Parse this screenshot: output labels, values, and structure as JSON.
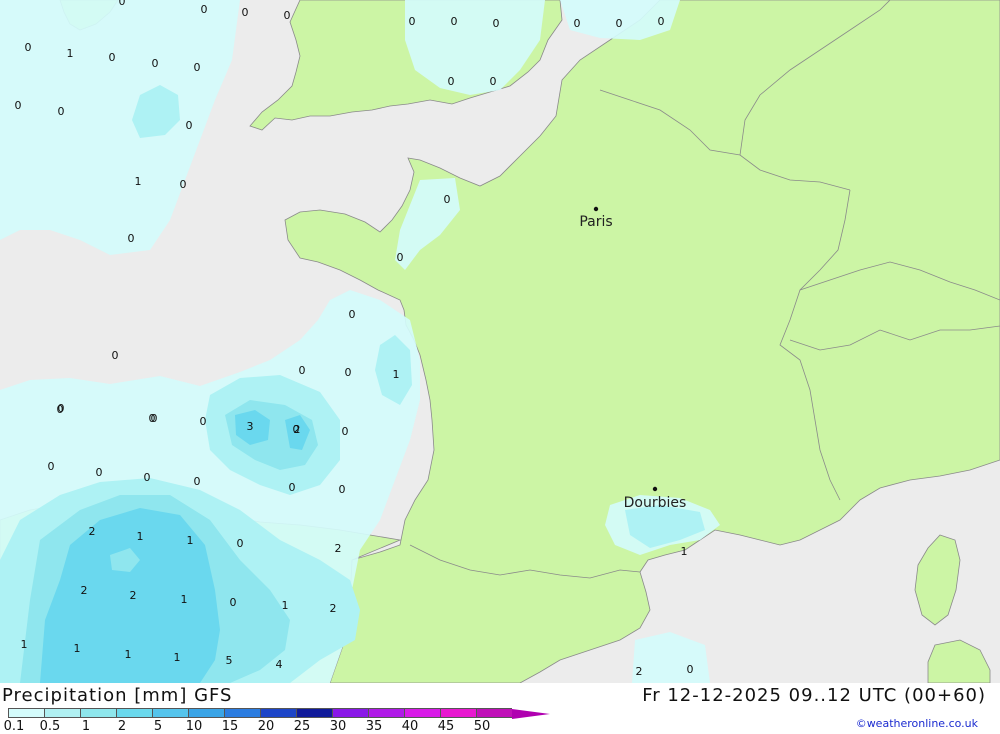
{
  "title": "Precipitation [mm] GFS",
  "datetime": "Fr 12-12-2025 09..12 UTC (00+60)",
  "credit": "©weatheronline.co.uk",
  "colors": {
    "sea": "#ececec",
    "land": "#ccf5a5",
    "border": "#8a8a8a",
    "level_0_1": "#d4fbfb",
    "level_0_5": "#aef2f4",
    "level_1": "#8fe6ee",
    "level_2": "#6ad8ee"
  },
  "legend": {
    "ticks": [
      "0.1",
      "0.5",
      "1",
      "2",
      "5",
      "10",
      "15",
      "20",
      "25",
      "30",
      "35",
      "40",
      "45",
      "50"
    ],
    "colors": [
      "#d4fbfb",
      "#b0f0f2",
      "#8ee6ec",
      "#6ad8ec",
      "#55c4ec",
      "#3aa4e6",
      "#2b7ce0",
      "#1d45c8",
      "#101a9a",
      "#8a18e8",
      "#b01ae8",
      "#d81ae8",
      "#e818d0",
      "#c010b8"
    ]
  },
  "cities": [
    {
      "name": "Paris"
    },
    {
      "name": "Dourbies"
    }
  ],
  "values": [
    "0",
    "0",
    "0",
    "0",
    "0",
    "0",
    "1",
    "0",
    "0",
    "0",
    "0",
    "0",
    "0",
    "0",
    "0",
    "0",
    "0",
    "0",
    "0",
    "0",
    "1",
    "0",
    "0",
    "0",
    "0",
    "0",
    "0",
    "0",
    "0",
    "0",
    "0",
    "0",
    "0",
    "1",
    "0",
    "0",
    "0",
    "3",
    "2",
    "0",
    "0",
    "0",
    "2",
    "1",
    "1",
    "0",
    "2",
    "1",
    "2",
    "1",
    "0",
    "1",
    "2",
    "2",
    "1",
    "1",
    "1",
    "1",
    "5",
    "4",
    "2",
    "0",
    "0",
    "0",
    "0"
  ]
}
